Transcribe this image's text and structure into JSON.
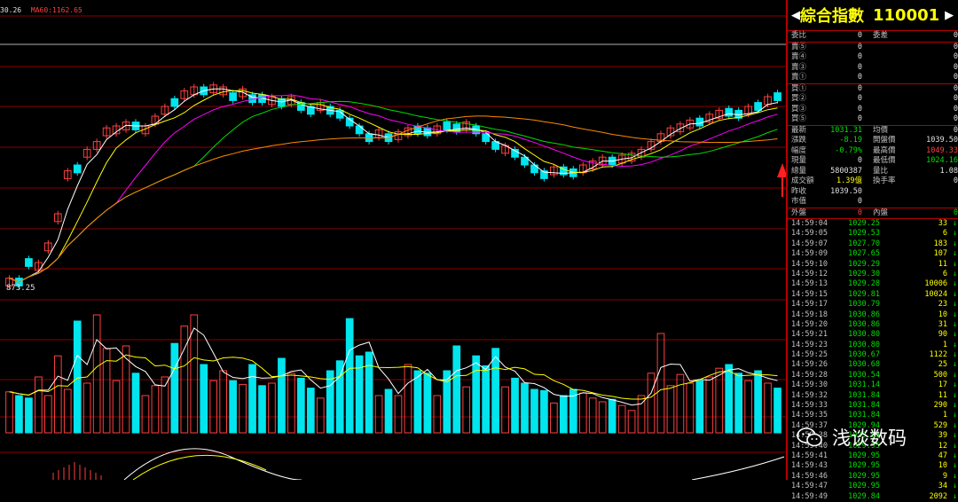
{
  "topbar": {
    "ma_value_1": "30.26",
    "ma_label_2": "MA60:1162.65"
  },
  "low_label": "873.25",
  "quote": {
    "header": {
      "left_arrow": "◀",
      "name": "綜合指數",
      "code": "110001",
      "right_arrow": "▶"
    },
    "ratio_row": {
      "l1": "委比",
      "v1": "0",
      "l2": "委差",
      "v2": "0"
    },
    "sell": [
      {
        "label": "賣⑤",
        "price": "0",
        "vol": "0"
      },
      {
        "label": "賣④",
        "price": "0",
        "vol": "0"
      },
      {
        "label": "賣③",
        "price": "0",
        "vol": "0"
      },
      {
        "label": "賣①",
        "price": "0",
        "vol": "0"
      }
    ],
    "buy": [
      {
        "label": "買①",
        "price": "0",
        "vol": "0"
      },
      {
        "label": "買②",
        "price": "0",
        "vol": "0"
      },
      {
        "label": "買③",
        "price": "0",
        "vol": "0"
      },
      {
        "label": "買⑤",
        "price": "0",
        "vol": "0"
      }
    ],
    "stats": [
      {
        "l1": "最新",
        "v1": "1031.31",
        "c1": "green",
        "l2": "均價",
        "v2": "0",
        "c2": "white"
      },
      {
        "l1": "漲跌",
        "v1": "-8.19",
        "c1": "green",
        "l2": "開盤價",
        "v2": "1039.50",
        "c2": "white"
      },
      {
        "l1": "幅度",
        "v1": "-0.79%",
        "c1": "green",
        "l2": "最高價",
        "v2": "1049.33",
        "c2": "red"
      },
      {
        "l1": "現量",
        "v1": "0",
        "c1": "white",
        "l2": "最低價",
        "v2": "1024.16",
        "c2": "green"
      },
      {
        "l1": "總量",
        "v1": "5800387",
        "c1": "white",
        "l2": "量比",
        "v2": "1.08",
        "c2": "white"
      },
      {
        "l1": "成交額",
        "v1": "1.39億",
        "c1": "yellow",
        "l2": "換手率",
        "v2": "0",
        "c2": "white"
      },
      {
        "l1": "昨收",
        "v1": "1039.50",
        "c1": "white",
        "l2": "",
        "v2": "",
        "c2": "white"
      },
      {
        "l1": "市值",
        "v1": "0",
        "c1": "white",
        "l2": "",
        "v2": "",
        "c2": "white"
      }
    ],
    "outer_inner": {
      "l1": "外盤",
      "v1": "0",
      "l2": "內盤",
      "v2": "0"
    },
    "ticks": [
      {
        "time": "14:59:04",
        "price": "1029.25",
        "vol": "33",
        "dir": "↓"
      },
      {
        "time": "14:59:05",
        "price": "1029.53",
        "vol": "6",
        "dir": "↓"
      },
      {
        "time": "14:59:07",
        "price": "1027.70",
        "vol": "183",
        "dir": "↓"
      },
      {
        "time": "14:59:09",
        "price": "1027.65",
        "vol": "107",
        "dir": "↓"
      },
      {
        "time": "14:59:10",
        "price": "1029.29",
        "vol": "11",
        "dir": "↓"
      },
      {
        "time": "14:59:12",
        "price": "1029.30",
        "vol": "6",
        "dir": "↓"
      },
      {
        "time": "14:59:13",
        "price": "1029.28",
        "vol": "10006",
        "dir": "↓"
      },
      {
        "time": "14:59:15",
        "price": "1029.81",
        "vol": "10024",
        "dir": "↓"
      },
      {
        "time": "14:59:17",
        "price": "1030.79",
        "vol": "23",
        "dir": "↓"
      },
      {
        "time": "14:59:18",
        "price": "1030.86",
        "vol": "10",
        "dir": "↓"
      },
      {
        "time": "14:59:20",
        "price": "1030.86",
        "vol": "31",
        "dir": "↓"
      },
      {
        "time": "14:59:21",
        "price": "1030.80",
        "vol": "90",
        "dir": "↓"
      },
      {
        "time": "14:59:23",
        "price": "1030.80",
        "vol": "1",
        "dir": "↓"
      },
      {
        "time": "14:59:25",
        "price": "1030.67",
        "vol": "1122",
        "dir": "↓"
      },
      {
        "time": "14:59:26",
        "price": "1030.68",
        "vol": "25",
        "dir": "↓"
      },
      {
        "time": "14:59:28",
        "price": "1030.54",
        "vol": "500",
        "dir": "↓"
      },
      {
        "time": "14:59:30",
        "price": "1031.14",
        "vol": "17",
        "dir": "↓"
      },
      {
        "time": "14:59:32",
        "price": "1031.84",
        "vol": "11",
        "dir": "↓"
      },
      {
        "time": "14:59:33",
        "price": "1031.84",
        "vol": "290",
        "dir": "↓"
      },
      {
        "time": "14:59:35",
        "price": "1031.84",
        "vol": "1",
        "dir": "↓"
      },
      {
        "time": "14:59:37",
        "price": "1029.94",
        "vol": "529",
        "dir": "↓"
      },
      {
        "time": "14:59:38",
        "price": "1029.95",
        "vol": "39",
        "dir": "↓"
      },
      {
        "time": "14:59:40",
        "price": "1029.95",
        "vol": "12",
        "dir": "↓"
      },
      {
        "time": "14:59:41",
        "price": "1029.95",
        "vol": "47",
        "dir": "↓"
      },
      {
        "time": "14:59:43",
        "price": "1029.95",
        "vol": "10",
        "dir": "↓"
      },
      {
        "time": "14:59:46",
        "price": "1029.95",
        "vol": "9",
        "dir": "↓"
      },
      {
        "time": "14:59:47",
        "price": "1029.95",
        "vol": "34",
        "dir": "↓"
      },
      {
        "time": "14:59:49",
        "price": "1029.84",
        "vol": "2092",
        "dir": "↓"
      }
    ]
  },
  "watermark": {
    "text": "浅谈数码"
  },
  "colors": {
    "grid": "#8a0000",
    "up": "#ff4040",
    "down": "#00e5ee",
    "ma5": "#ffffff",
    "ma10": "#ffff00",
    "ma20": "#ff00ff",
    "ma30": "#00dd00",
    "ma60": "#ff8800"
  },
  "chart_data": {
    "type": "candlestick",
    "candles": [
      [
        1,
        0,
        -1,
        0.33
      ],
      [
        0,
        0,
        1,
        0.3
      ],
      [
        0,
        0.1,
        -1,
        0.28
      ],
      [
        1,
        0.08,
        -1,
        0.45
      ],
      [
        1,
        0.18,
        -1,
        0.3
      ],
      [
        1,
        0.33,
        -1,
        0.62
      ],
      [
        1,
        0.55,
        -1,
        0.35
      ],
      [
        0,
        0.58,
        1,
        0.9
      ],
      [
        1,
        0.66,
        -1,
        0.4
      ],
      [
        1,
        0.7,
        -1,
        0.95
      ],
      [
        1,
        0.77,
        -1,
        0.68
      ],
      [
        1,
        0.78,
        -1,
        0.42
      ],
      [
        1,
        0.8,
        -1,
        0.7
      ],
      [
        0,
        0.8,
        1,
        0.48
      ],
      [
        1,
        0.78,
        -1,
        0.3
      ],
      [
        1,
        0.83,
        -1,
        0.38
      ],
      [
        1,
        0.88,
        -1,
        0.45
      ],
      [
        0,
        0.92,
        1,
        0.72
      ],
      [
        1,
        0.96,
        -1,
        0.86
      ],
      [
        1,
        0.98,
        -1,
        0.95
      ],
      [
        0,
        0.98,
        1,
        0.55
      ],
      [
        1,
        0.99,
        -1,
        0.42
      ],
      [
        1,
        0.98,
        -1,
        0.5
      ],
      [
        0,
        0.95,
        1,
        0.42
      ],
      [
        1,
        0.97,
        -1,
        0.39
      ],
      [
        0,
        0.94,
        1,
        0.55
      ],
      [
        0,
        0.94,
        1,
        0.38
      ],
      [
        1,
        0.93,
        -1,
        0.4
      ],
      [
        0,
        0.92,
        1,
        0.6
      ],
      [
        1,
        0.93,
        -1,
        0.48
      ],
      [
        0,
        0.9,
        1,
        0.44
      ],
      [
        0,
        0.88,
        1,
        0.36
      ],
      [
        1,
        0.9,
        -1,
        0.28
      ],
      [
        0,
        0.88,
        1,
        0.5
      ],
      [
        0,
        0.86,
        1,
        0.58
      ],
      [
        0,
        0.82,
        1,
        0.92
      ],
      [
        0,
        0.78,
        1,
        0.62
      ],
      [
        0,
        0.74,
        1,
        0.65
      ],
      [
        1,
        0.76,
        -1,
        0.3
      ],
      [
        0,
        0.74,
        1,
        0.35
      ],
      [
        1,
        0.75,
        -1,
        0.3
      ],
      [
        1,
        0.77,
        -1,
        0.55
      ],
      [
        0,
        0.78,
        1,
        0.5
      ],
      [
        0,
        0.77,
        1,
        0.48
      ],
      [
        1,
        0.78,
        -1,
        0.3
      ],
      [
        0,
        0.8,
        1,
        0.5
      ],
      [
        0,
        0.79,
        1,
        0.7
      ],
      [
        1,
        0.8,
        -1,
        0.37
      ],
      [
        0,
        0.78,
        1,
        0.62
      ],
      [
        0,
        0.74,
        1,
        0.54
      ],
      [
        0,
        0.7,
        1,
        0.68
      ],
      [
        1,
        0.68,
        -1,
        0.37
      ],
      [
        0,
        0.66,
        1,
        0.44
      ],
      [
        0,
        0.62,
        1,
        0.4
      ],
      [
        0,
        0.58,
        1,
        0.35
      ],
      [
        0,
        0.55,
        1,
        0.34
      ],
      [
        1,
        0.57,
        -1,
        0.24
      ],
      [
        0,
        0.57,
        1,
        0.3
      ],
      [
        0,
        0.56,
        1,
        0.35
      ],
      [
        1,
        0.58,
        -1,
        0.32
      ],
      [
        1,
        0.6,
        -1,
        0.28
      ],
      [
        1,
        0.62,
        -1,
        0.25
      ],
      [
        0,
        0.62,
        1,
        0.27
      ],
      [
        1,
        0.63,
        -1,
        0.22
      ],
      [
        1,
        0.64,
        -1,
        0.18
      ],
      [
        1,
        0.66,
        -1,
        0.3
      ],
      [
        1,
        0.7,
        -1,
        0.48
      ],
      [
        1,
        0.74,
        -1,
        0.8
      ],
      [
        1,
        0.77,
        -1,
        0.38
      ],
      [
        1,
        0.79,
        -1,
        0.47
      ],
      [
        1,
        0.81,
        -1,
        0.4
      ],
      [
        0,
        0.82,
        1,
        0.42
      ],
      [
        1,
        0.84,
        -1,
        0.45
      ],
      [
        1,
        0.86,
        -1,
        0.52
      ],
      [
        0,
        0.87,
        1,
        0.55
      ],
      [
        0,
        0.86,
        1,
        0.48
      ],
      [
        1,
        0.88,
        -1,
        0.42
      ],
      [
        0,
        0.9,
        1,
        0.5
      ],
      [
        1,
        0.93,
        -1,
        0.4
      ],
      [
        0,
        0.95,
        1,
        0.36
      ]
    ]
  }
}
